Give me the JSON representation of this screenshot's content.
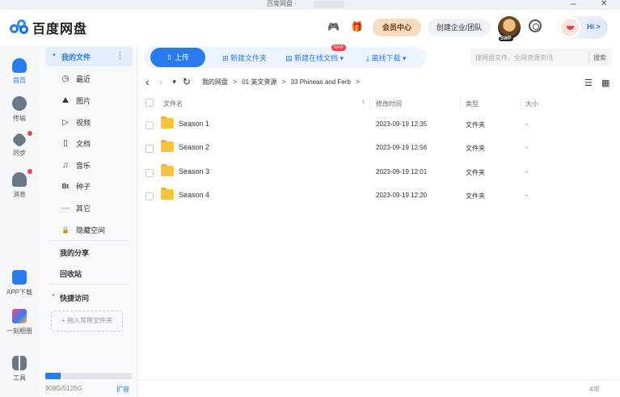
{
  "window": {
    "title": "百度网盘 ·",
    "min": "–",
    "close": "✕"
  },
  "header": {
    "logo_text": "百度网盘",
    "game_icon": "🎮",
    "gift_icon": "🎁",
    "vip_label": "会员中心",
    "enterprise_label": "创建企业/团队",
    "avatar_badge": "SWP",
    "hi_label": "Hi >"
  },
  "leftnav": {
    "items": [
      {
        "label": "首页",
        "icon": "cloud-icon"
      },
      {
        "label": "传输",
        "icon": "transfer-icon"
      },
      {
        "label": "同步",
        "icon": "sync-icon"
      },
      {
        "label": "消息",
        "icon": "message-icon"
      },
      {
        "label": "APP下载",
        "icon": "app-download-icon"
      },
      {
        "label": "一刻相册",
        "icon": "album-icon"
      },
      {
        "label": "工具",
        "icon": "tools-icon"
      }
    ]
  },
  "sidepanel": {
    "my_files": "我的文件",
    "menu_dots": "⋮",
    "items": [
      {
        "label": "最近",
        "icon": "clock-icon",
        "glyph": "◷"
      },
      {
        "label": "图片",
        "icon": "image-icon",
        "glyph": "⛰"
      },
      {
        "label": "视频",
        "icon": "video-icon",
        "glyph": "▷"
      },
      {
        "label": "文档",
        "icon": "document-icon",
        "glyph": "▯"
      },
      {
        "label": "音乐",
        "icon": "music-icon",
        "glyph": "♫"
      },
      {
        "label": "种子",
        "icon": "bt-icon",
        "glyph": "Bt"
      },
      {
        "label": "其它",
        "icon": "other-icon",
        "glyph": "···"
      },
      {
        "label": "隐藏空间",
        "icon": "lock-icon",
        "glyph": "🔒"
      }
    ],
    "my_share": "我的分享",
    "recycle": "回收站",
    "quick_access": "快捷访问",
    "add_favorite": "+ 拖入常用文件夹",
    "quota_text": "908G/5125G",
    "quota_fraction": 0.177,
    "expand": "扩容"
  },
  "toolbar": {
    "upload": "上传",
    "new_folder": "新建文件夹",
    "new_doc": "新建在线文档 ▾",
    "new_badge": "NEW",
    "offline_download": "离线下载 ▾",
    "search_placeholder": "搜网盘文件、全网资源资讯",
    "search_button": "搜索"
  },
  "breadcrumb": {
    "back": "‹",
    "forward": "›",
    "dropdown": "▾",
    "refresh": "↻",
    "parts": [
      "我的网盘",
      "01 英文资源",
      "33 Phineas and Ferb"
    ],
    "sep": ">"
  },
  "table": {
    "headers": {
      "name": "文件名",
      "modified": "修改时间",
      "type": "类型",
      "size": "大小"
    },
    "rows": [
      {
        "name": "Season 1",
        "modified": "2023-09-19 12:35",
        "type": "文件夹",
        "size": "-"
      },
      {
        "name": "Season 2",
        "modified": "2023-09-19 12:56",
        "type": "文件夹",
        "size": "-"
      },
      {
        "name": "Season 3",
        "modified": "2023-09-19 12:01",
        "type": "文件夹",
        "size": "-"
      },
      {
        "name": "Season 4",
        "modified": "2023-09-19 12:20",
        "type": "文件夹",
        "size": "-"
      }
    ],
    "count": "4项"
  },
  "colors": {
    "accent": "#2b7bf0",
    "folder": "#f7c43c",
    "vip": "#f9dcc0"
  }
}
